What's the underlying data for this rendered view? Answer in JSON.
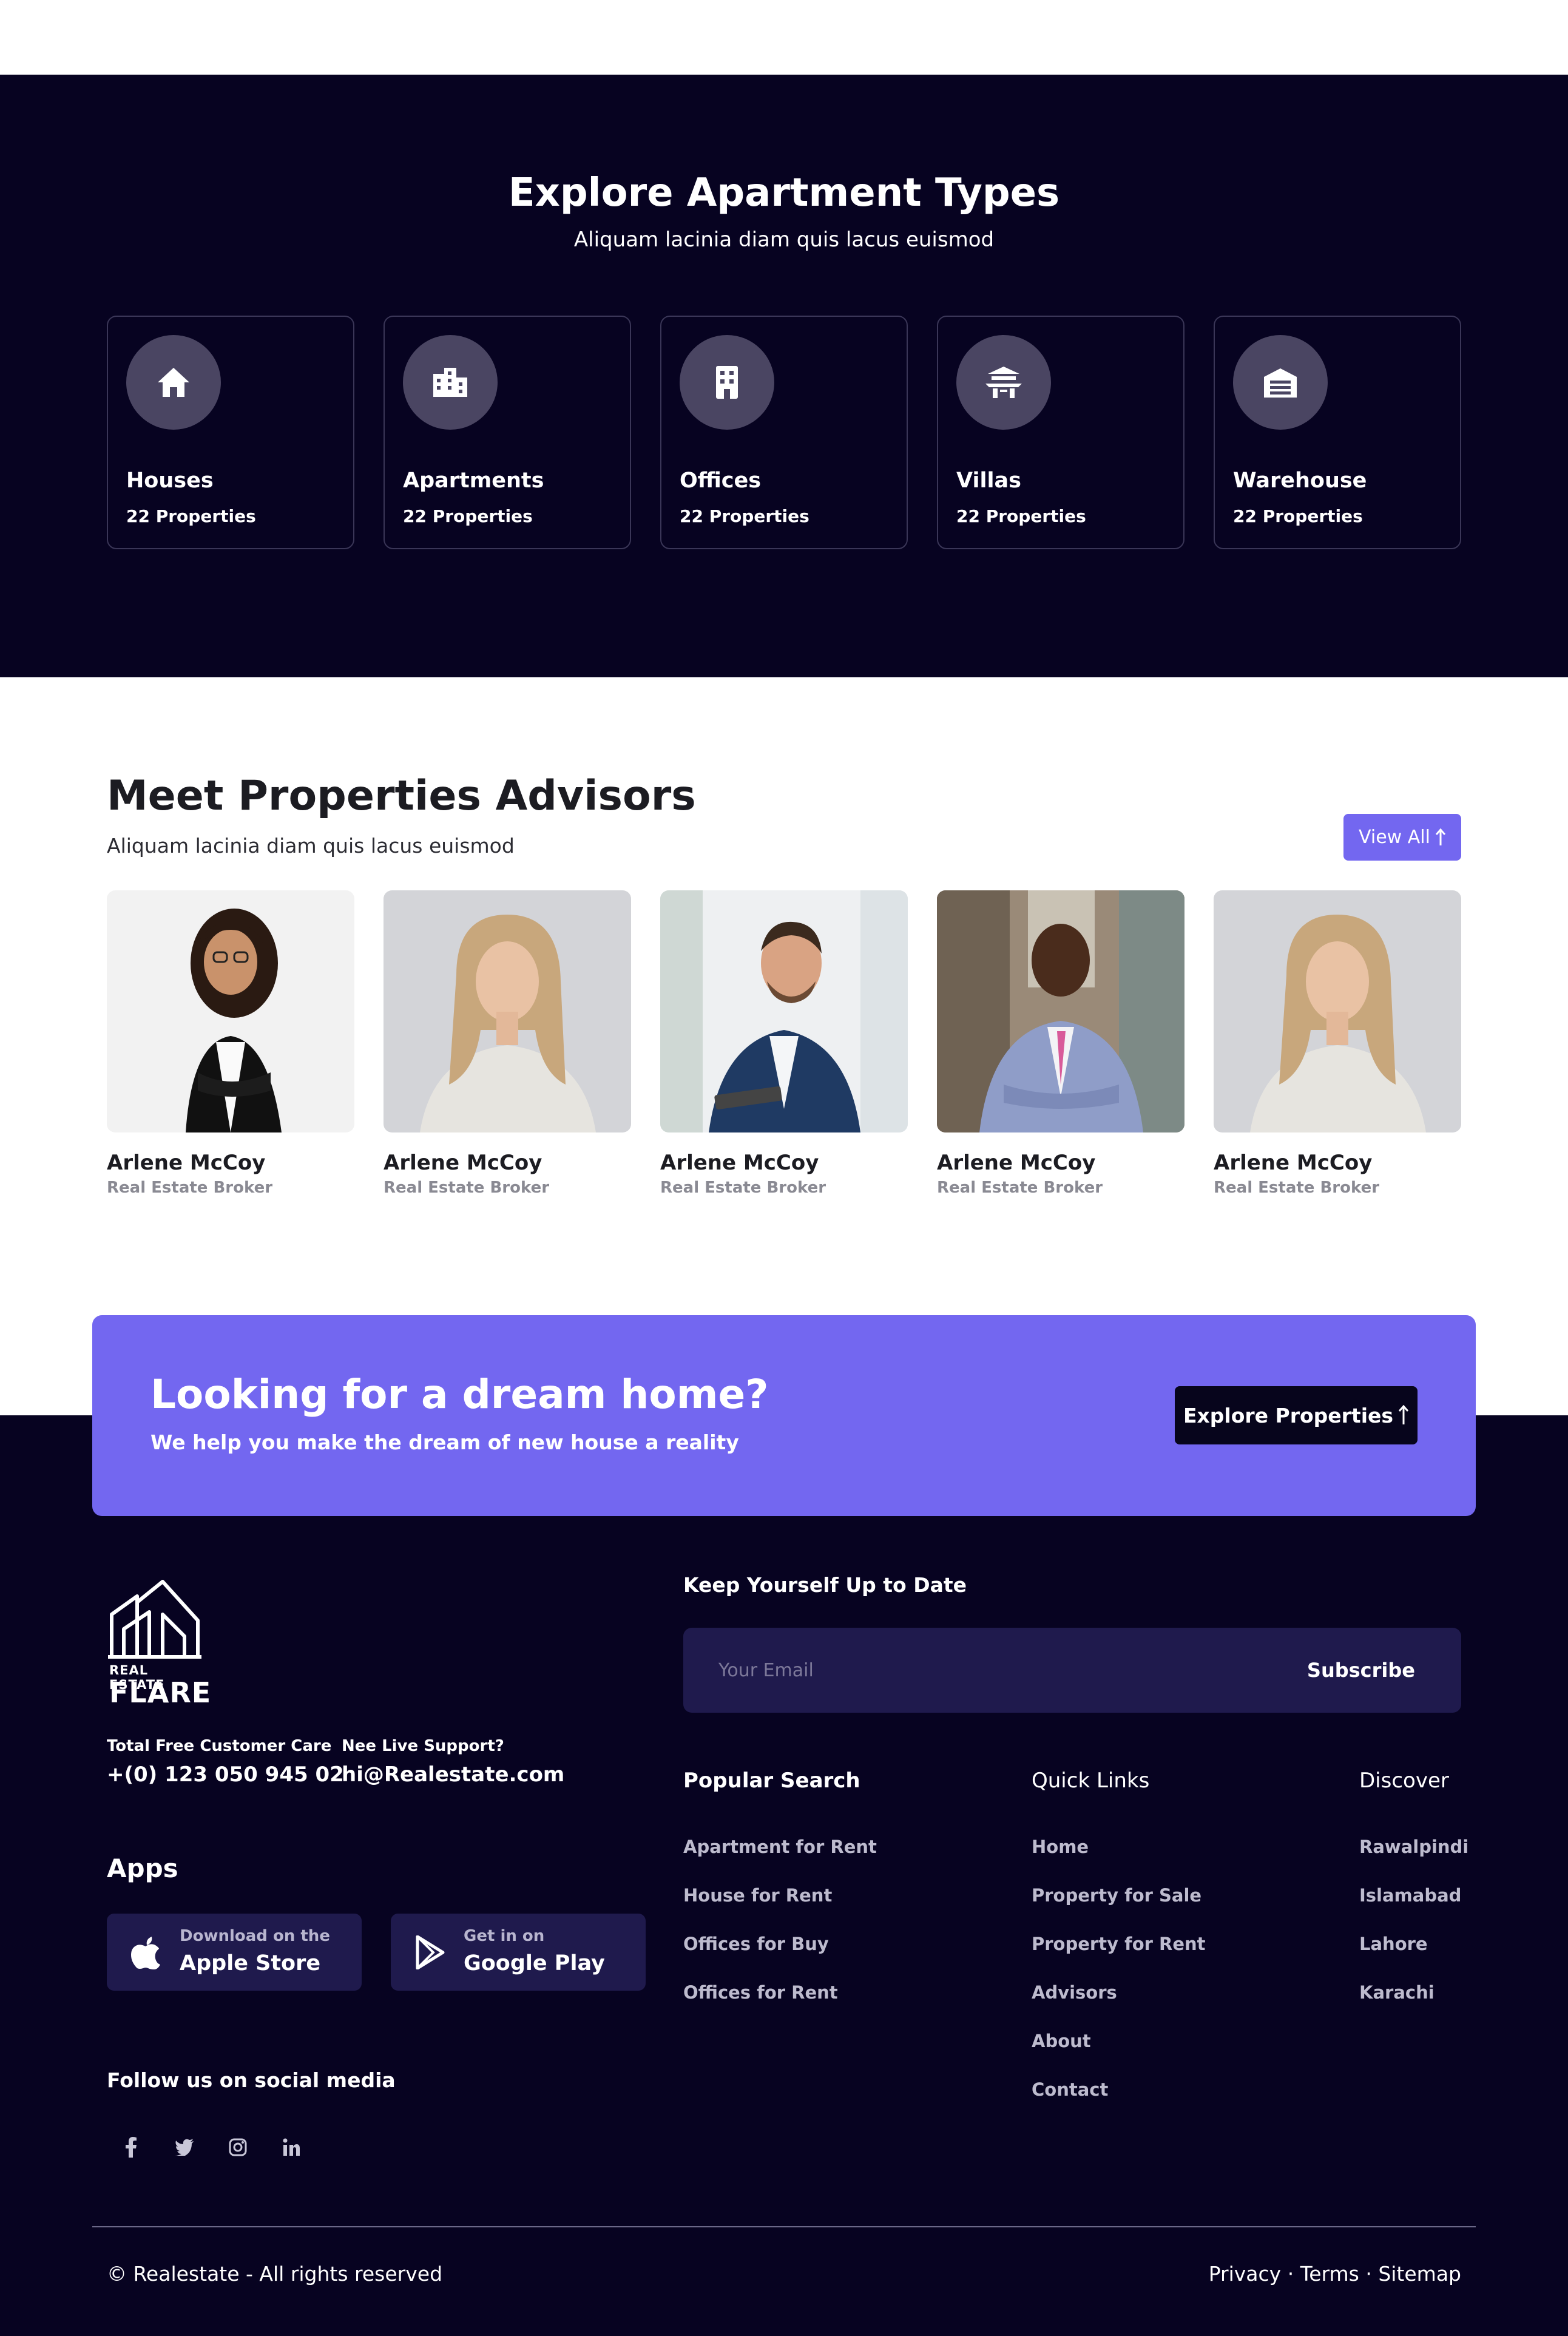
{
  "types": {
    "title": "Explore Apartment Types",
    "subtitle": "Aliquam lacinia diam quis lacus euismod",
    "items": [
      {
        "name": "Houses",
        "count": "22 Properties",
        "icon": "house-icon"
      },
      {
        "name": "Apartments",
        "count": "22 Properties",
        "icon": "apartment-building-icon"
      },
      {
        "name": "Offices",
        "count": "22 Properties",
        "icon": "office-building-icon"
      },
      {
        "name": "Villas",
        "count": "22 Properties",
        "icon": "villa-pagoda-icon"
      },
      {
        "name": "Warehouse",
        "count": "22 Properties",
        "icon": "warehouse-icon"
      }
    ]
  },
  "advisors": {
    "title": "Meet Properties Advisors",
    "subtitle": "Aliquam lacinia diam quis lacus euismod",
    "view_all": "View All",
    "items": [
      {
        "name": "Arlene McCoy",
        "role": "Real Estate Broker"
      },
      {
        "name": "Arlene McCoy",
        "role": "Real Estate Broker"
      },
      {
        "name": "Arlene McCoy",
        "role": "Real Estate Broker"
      },
      {
        "name": "Arlene McCoy",
        "role": "Real Estate Broker"
      },
      {
        "name": "Arlene McCoy",
        "role": "Real Estate Broker"
      }
    ]
  },
  "cta": {
    "title": "Looking for a dream home?",
    "subtitle": "We help you make the dream of new house a reality",
    "button": "Explore Properties"
  },
  "footer": {
    "logo_small": "REAL ESTATE",
    "logo_big": "FLARE",
    "care_label": "Total Free Customer Care",
    "care_value": "+(0) 123 050 945 02",
    "support_label": "Nee Live Support?",
    "support_value": "hi@Realestate.com",
    "apps_title": "Apps",
    "apple_small": "Download on the",
    "apple_big": "Apple Store",
    "google_small": "Get in on",
    "google_big": "Google Play",
    "follow": "Follow us on social media",
    "newsletter_title": "Keep Yourself Up to Date",
    "email_placeholder": "Your Email",
    "subscribe": "Subscribe",
    "popular_title": "Popular Search",
    "popular": [
      "Apartment for Rent",
      "House for Rent",
      "Offices for Buy",
      "Offices for Rent"
    ],
    "quick_title": "Quick Links",
    "quick": [
      "Home",
      "Property for Sale",
      "Property for Rent",
      "Advisors",
      "About",
      "Contact"
    ],
    "discover_title": "Discover",
    "discover": [
      "Rawalpindi",
      "Islamabad",
      "Lahore",
      "Karachi"
    ],
    "copyright": "© Realestate - All rights reserved",
    "legal": "Privacy · Terms · Sitemap"
  },
  "colors": {
    "dark": "#070321",
    "accent": "#7367f0",
    "panel": "#1f1a4d"
  }
}
